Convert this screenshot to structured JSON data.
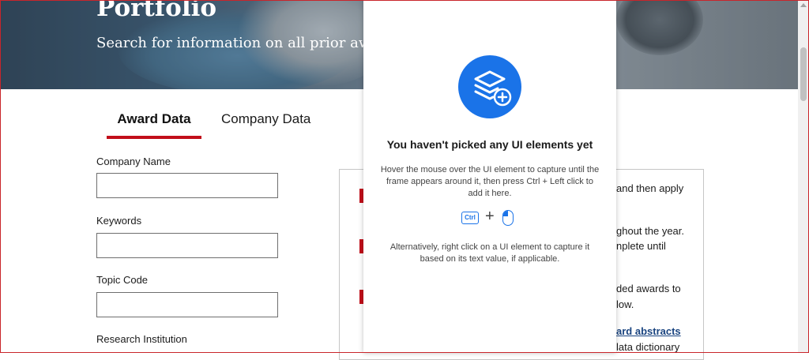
{
  "hero": {
    "title": "Portfolio",
    "subtitle": "Search for information on all prior awar"
  },
  "tabs": {
    "award": "Award Data",
    "company": "Company Data"
  },
  "form": {
    "company_name_label": "Company Name",
    "company_name_value": "",
    "keywords_label": "Keywords",
    "keywords_value": "",
    "topic_code_label": "Topic Code",
    "topic_code_value": "",
    "research_institution_label": "Research Institution"
  },
  "info": {
    "line1": "and then apply",
    "line2": "ghout the year.",
    "line3": "nplete until",
    "line4": "ded awards to",
    "line5": "low.",
    "link": "ard abstracts",
    "line6": "lata dictionary"
  },
  "overlay": {
    "title": "You haven't picked any UI elements yet",
    "description": "Hover the mouse over the UI element to capture until the frame appears around it, then press Ctrl + Left click to add it here.",
    "ctrl_key": "Ctrl",
    "plus": "+",
    "alternative": "Alternatively, right click on a UI element to capture it based on its text value, if applicable."
  },
  "colors": {
    "accent_red": "#c20e1a",
    "picker_blue": "#1a73e8"
  },
  "icons": [
    "layers-add-icon",
    "ctrl-key-icon",
    "mouse-left-click-icon",
    "scroll-up-icon"
  ]
}
